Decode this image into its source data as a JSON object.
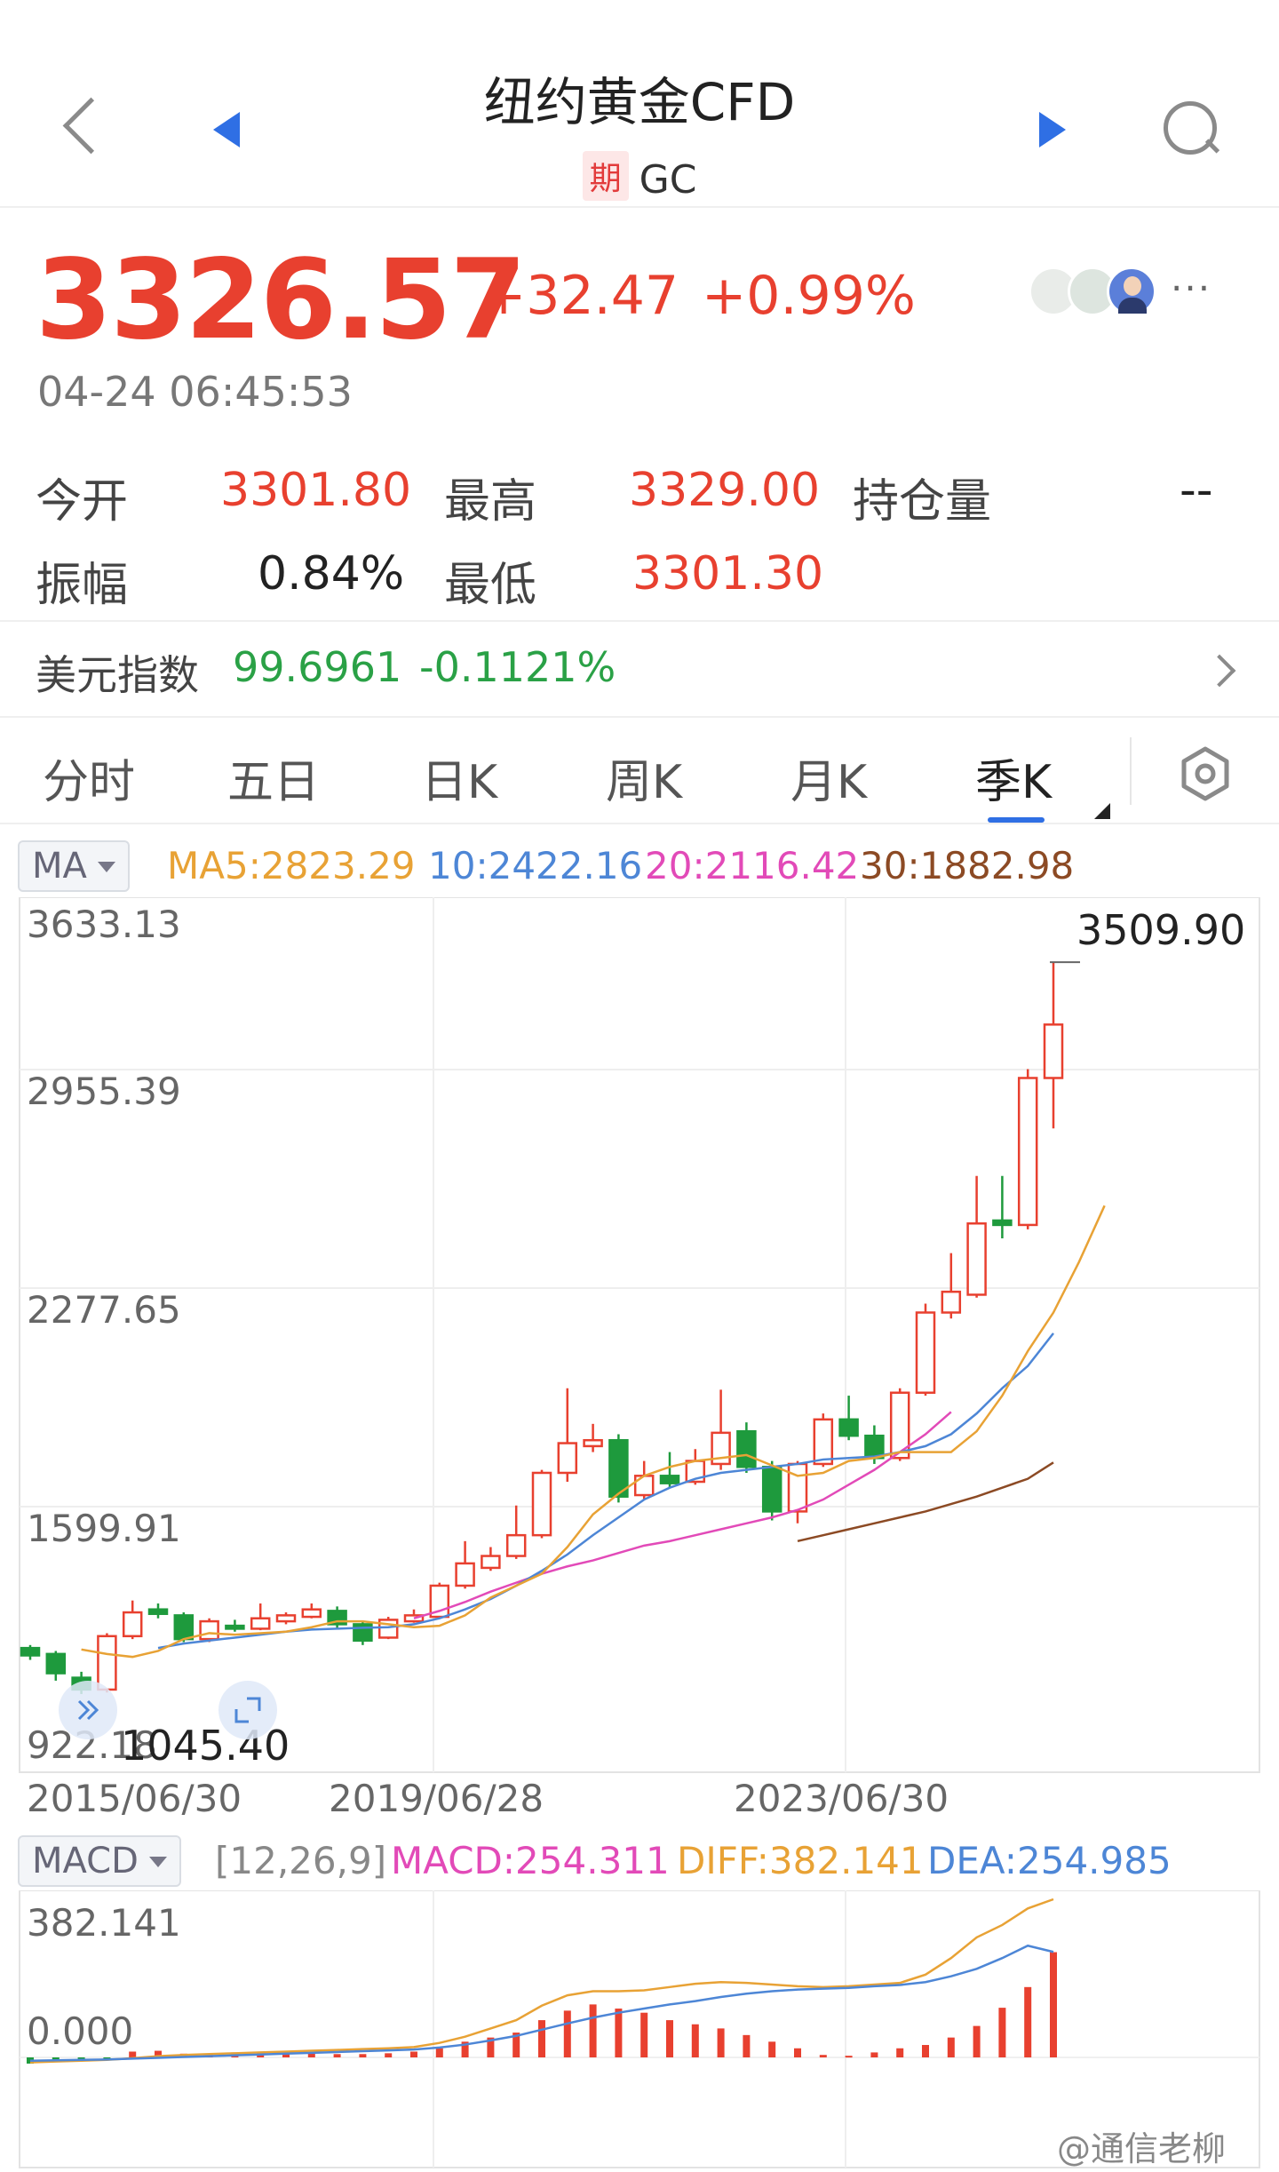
{
  "header": {
    "title": "纽约黄金CFD",
    "badge": "期",
    "code": "GC"
  },
  "quote": {
    "price": "3326.57",
    "change": "+32.47",
    "change_pct": "+0.99%",
    "time": "04-24 06:45:53",
    "more": "···"
  },
  "stats": {
    "open_label": "今开",
    "open": "3301.80",
    "high_label": "最高",
    "high": "3329.00",
    "oi_label": "持仓量",
    "oi": "--",
    "amp_label": "振幅",
    "amp": "0.84%",
    "low_label": "最低",
    "low": "3301.30"
  },
  "usd_index": {
    "label": "美元指数",
    "value": "99.6961",
    "change": "-0.1121%"
  },
  "tabs": [
    "分时",
    "五日",
    "日K",
    "周K",
    "月K",
    "季K"
  ],
  "active_tab": "季K",
  "ma_legend": {
    "selector": "MA",
    "ma5": "MA5:2823.29",
    "ma10": "10:2422.16",
    "ma20": "20:2116.42",
    "ma30": "30:1882.98"
  },
  "macd_legend": {
    "selector": "MACD",
    "params": "[12,26,9]",
    "macd": "MACD:254.311",
    "diff": "DIFF:382.141",
    "dea": "DEA:254.985"
  },
  "watermark": "@通信老柳",
  "chart_data": [
    {
      "type": "candlestick",
      "y_ticks": [
        "3633.13",
        "2955.39",
        "2277.65",
        "1599.91",
        "922.18"
      ],
      "ylim": [
        922.18,
        3633.13
      ],
      "x_ticks": [
        "2015/06/30",
        "2019/06/28",
        "2023/06/30"
      ],
      "max_label": "3509.90",
      "min_label": "1045.40",
      "candles": [
        {
          "o": 1200,
          "c": 1175,
          "h": 1210,
          "l": 1160
        },
        {
          "o": 1180,
          "c": 1115,
          "h": 1190,
          "l": 1090
        },
        {
          "o": 1100,
          "c": 1060,
          "h": 1120,
          "l": 1045
        },
        {
          "o": 1060,
          "c": 1240,
          "h": 1250,
          "l": 1050
        },
        {
          "o": 1240,
          "c": 1320,
          "h": 1360,
          "l": 1230
        },
        {
          "o": 1330,
          "c": 1315,
          "h": 1350,
          "l": 1300
        },
        {
          "o": 1310,
          "c": 1230,
          "h": 1320,
          "l": 1220
        },
        {
          "o": 1230,
          "c": 1290,
          "h": 1300,
          "l": 1220
        },
        {
          "o": 1275,
          "c": 1265,
          "h": 1295,
          "l": 1255
        },
        {
          "o": 1265,
          "c": 1300,
          "h": 1350,
          "l": 1260
        },
        {
          "o": 1290,
          "c": 1310,
          "h": 1320,
          "l": 1280
        },
        {
          "o": 1305,
          "c": 1330,
          "h": 1350,
          "l": 1300
        },
        {
          "o": 1325,
          "c": 1280,
          "h": 1340,
          "l": 1265
        },
        {
          "o": 1280,
          "c": 1225,
          "h": 1290,
          "l": 1210
        },
        {
          "o": 1235,
          "c": 1295,
          "h": 1305,
          "l": 1230
        },
        {
          "o": 1290,
          "c": 1310,
          "h": 1330,
          "l": 1285
        },
        {
          "o": 1305,
          "c": 1410,
          "h": 1420,
          "l": 1300
        },
        {
          "o": 1410,
          "c": 1485,
          "h": 1560,
          "l": 1400
        },
        {
          "o": 1470,
          "c": 1510,
          "h": 1540,
          "l": 1460
        },
        {
          "o": 1510,
          "c": 1580,
          "h": 1680,
          "l": 1500
        },
        {
          "o": 1580,
          "c": 1790,
          "h": 1800,
          "l": 1570
        },
        {
          "o": 1790,
          "c": 1890,
          "h": 2075,
          "l": 1760
        },
        {
          "o": 1880,
          "c": 1900,
          "h": 1955,
          "l": 1860
        },
        {
          "o": 1900,
          "c": 1710,
          "h": 1920,
          "l": 1690
        },
        {
          "o": 1715,
          "c": 1780,
          "h": 1830,
          "l": 1700
        },
        {
          "o": 1780,
          "c": 1755,
          "h": 1860,
          "l": 1740
        },
        {
          "o": 1760,
          "c": 1830,
          "h": 1870,
          "l": 1750
        },
        {
          "o": 1820,
          "c": 1925,
          "h": 2070,
          "l": 1800
        },
        {
          "o": 1930,
          "c": 1810,
          "h": 1960,
          "l": 1790
        },
        {
          "o": 1810,
          "c": 1660,
          "h": 1830,
          "l": 1630
        },
        {
          "o": 1660,
          "c": 1820,
          "h": 1830,
          "l": 1620
        },
        {
          "o": 1820,
          "c": 1970,
          "h": 1990,
          "l": 1810
        },
        {
          "o": 1970,
          "c": 1915,
          "h": 2050,
          "l": 1900
        },
        {
          "o": 1915,
          "c": 1840,
          "h": 1950,
          "l": 1820
        },
        {
          "o": 1840,
          "c": 2060,
          "h": 2075,
          "l": 1830
        },
        {
          "o": 2060,
          "c": 2330,
          "h": 2360,
          "l": 2050
        },
        {
          "o": 2330,
          "c": 2400,
          "h": 2530,
          "l": 2310
        },
        {
          "o": 2390,
          "c": 2630,
          "h": 2790,
          "l": 2380
        },
        {
          "o": 2640,
          "c": 2625,
          "h": 2790,
          "l": 2580
        },
        {
          "o": 2625,
          "c": 3120,
          "h": 3150,
          "l": 2610
        },
        {
          "o": 3120,
          "c": 3300,
          "h": 3509.9,
          "l": 2950
        }
      ],
      "ma5_start": 2,
      "ma5": [
        1195,
        1180,
        1170,
        1190,
        1230,
        1250,
        1245,
        1250,
        1255,
        1270,
        1290,
        1290,
        1280,
        1270,
        1275,
        1310,
        1370,
        1410,
        1450,
        1540,
        1650,
        1720,
        1780,
        1810,
        1830,
        1840,
        1850,
        1815,
        1780,
        1790,
        1830,
        1840,
        1860,
        1860,
        1860,
        1930,
        2050,
        2200,
        2330,
        2500,
        2690
      ],
      "ma10_start": 5,
      "ma10": [
        1200,
        1215,
        1225,
        1235,
        1245,
        1255,
        1262,
        1265,
        1268,
        1270,
        1280,
        1300,
        1330,
        1365,
        1410,
        1460,
        1515,
        1580,
        1640,
        1700,
        1740,
        1770,
        1790,
        1800,
        1810,
        1820,
        1835,
        1840,
        1845,
        1860,
        1880,
        1920,
        1990,
        2075,
        2150,
        2260
      ],
      "ma20_start": 15,
      "ma20": [
        1300,
        1325,
        1355,
        1390,
        1420,
        1450,
        1475,
        1495,
        1520,
        1545,
        1560,
        1580,
        1600,
        1620,
        1640,
        1665,
        1700,
        1750,
        1800,
        1860,
        1920,
        1995
      ],
      "ma30_start": 30,
      "ma30": [
        1560,
        1580,
        1600,
        1620,
        1640,
        1660,
        1685,
        1710,
        1740,
        1770,
        1825
      ],
      "colors": {
        "up": "#e8402f",
        "down": "#1e9a3d",
        "ma5": "#e8a235",
        "ma10": "#4d86d6",
        "ma20": "#e24ab8",
        "ma30": "#8c4a24"
      }
    },
    {
      "type": "bar",
      "name": "MACD",
      "y_ticks": [
        "382.141",
        "0.000"
      ],
      "macd": [
        -15,
        -10,
        -6,
        -3,
        14,
        16,
        9,
        9,
        12,
        13,
        11,
        10,
        8,
        8,
        10,
        14,
        22,
        38,
        48,
        60,
        90,
        113,
        128,
        118,
        108,
        90,
        80,
        70,
        54,
        38,
        22,
        6,
        4,
        12,
        22,
        30,
        48,
        76,
        120,
        170,
        254.311
      ],
      "diff": [
        -12,
        -10,
        -8,
        -6,
        -2,
        3,
        6,
        8,
        10,
        12,
        14,
        16,
        18,
        20,
        22,
        25,
        35,
        50,
        70,
        90,
        125,
        150,
        160,
        160,
        162,
        170,
        178,
        182,
        180,
        176,
        172,
        170,
        172,
        176,
        180,
        200,
        240,
        290,
        320,
        360,
        382.141
      ],
      "dea": [
        -8,
        -7,
        -6,
        -5,
        -3,
        -1,
        1,
        3,
        5,
        7,
        9,
        11,
        13,
        15,
        17,
        19,
        24,
        31,
        41,
        52,
        67,
        82,
        96,
        108,
        118,
        128,
        136,
        146,
        154,
        160,
        164,
        166,
        168,
        172,
        175,
        182,
        196,
        214,
        240,
        270,
        254.985
      ],
      "colors": {
        "macd": "#e24ab8",
        "diff": "#e8a235",
        "dea": "#4d86d6",
        "bar_up": "#e8402f",
        "bar_down": "#1e9a3d"
      }
    }
  ]
}
